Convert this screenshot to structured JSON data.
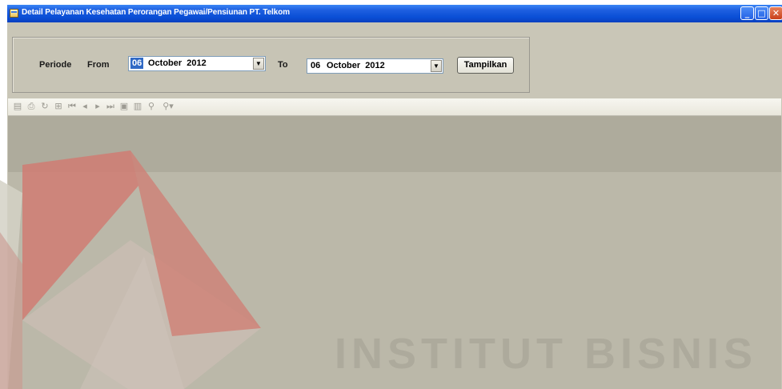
{
  "window": {
    "title": "Detail Pelayanan Kesehatan Perorangan Pegawai/Pensiunan PT. Telkom",
    "controls": {
      "minimize": "_",
      "maximize": "□",
      "close": "✕"
    }
  },
  "filter": {
    "periode_label": "Periode",
    "from_label": "From",
    "from_date": {
      "day": "06",
      "rest": "October  2012"
    },
    "to_label": "To",
    "to_date": {
      "day": "06",
      "rest": "October  2012"
    },
    "show_button": "Tampilkan"
  },
  "toolbar": {
    "icons": [
      "export-icon",
      "print-icon",
      "refresh-icon",
      "group-tree-icon",
      "first-page-icon",
      "prev-page-icon",
      "next-page-icon",
      "last-page-icon",
      "goto-page-icon",
      "close-view-icon",
      "find-icon",
      "zoom-icon"
    ]
  },
  "watermark": {
    "text": "INSTITUT BISNIS"
  },
  "colors": {
    "titlebar": "#0a4fd6",
    "selection": "#316ac5",
    "watermark_red": "#d27f78",
    "viewer_bg": "#bbb8a9"
  }
}
